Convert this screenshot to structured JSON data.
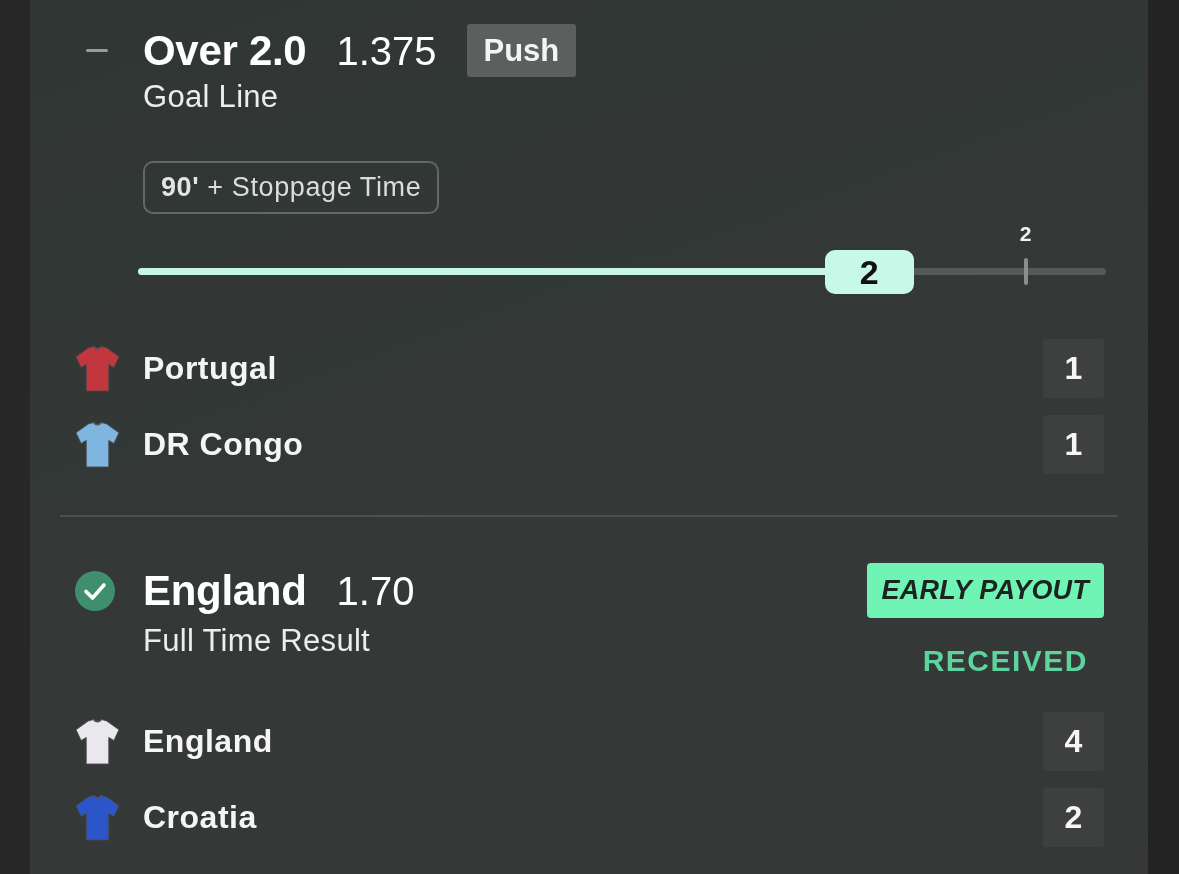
{
  "bets": [
    {
      "kind": "push",
      "selection": "Over 2.0",
      "odds": "1.375",
      "result_tag": "Push",
      "market": "Goal Line",
      "period": "**90'** + Stoppage Time",
      "progress": {
        "level": 0.755,
        "label": "2",
        "target": {
          "level": 0.917,
          "label": "2"
        }
      },
      "teams": [
        {
          "name": "Portugal",
          "color": "#c2363e",
          "score": "1"
        },
        {
          "name": "DR Congo",
          "color": "#7fb6e0",
          "score": "1"
        }
      ]
    },
    {
      "kind": "won",
      "selection": "England",
      "odds": "1.70",
      "market": "Full Time Result",
      "promo": {
        "label": "EARLY PAYOUT",
        "status": "RECEIVED"
      },
      "teams": [
        {
          "name": "England",
          "color": "#ebe7ee",
          "score": "4"
        },
        {
          "name": "Croatia",
          "color": "#2b55c9",
          "score": "2"
        }
      ]
    }
  ]
}
